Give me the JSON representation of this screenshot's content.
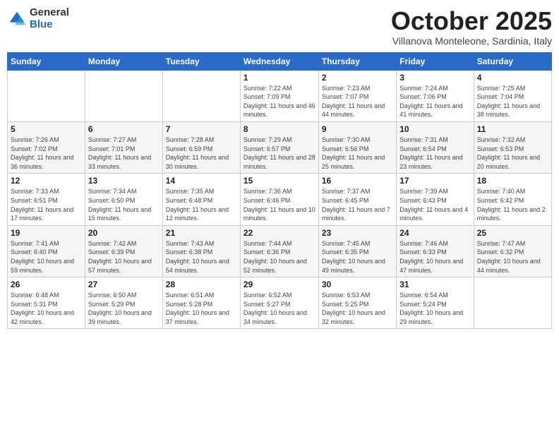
{
  "logo": {
    "general": "General",
    "blue": "Blue"
  },
  "title": "October 2025",
  "subtitle": "Villanova Monteleone, Sardinia, Italy",
  "days_header": [
    "Sunday",
    "Monday",
    "Tuesday",
    "Wednesday",
    "Thursday",
    "Friday",
    "Saturday"
  ],
  "weeks": [
    [
      {
        "day": "",
        "info": ""
      },
      {
        "day": "",
        "info": ""
      },
      {
        "day": "",
        "info": ""
      },
      {
        "day": "1",
        "info": "Sunrise: 7:22 AM\nSunset: 7:09 PM\nDaylight: 11 hours and 46 minutes."
      },
      {
        "day": "2",
        "info": "Sunrise: 7:23 AM\nSunset: 7:07 PM\nDaylight: 11 hours and 44 minutes."
      },
      {
        "day": "3",
        "info": "Sunrise: 7:24 AM\nSunset: 7:06 PM\nDaylight: 11 hours and 41 minutes."
      },
      {
        "day": "4",
        "info": "Sunrise: 7:25 AM\nSunset: 7:04 PM\nDaylight: 11 hours and 38 minutes."
      }
    ],
    [
      {
        "day": "5",
        "info": "Sunrise: 7:26 AM\nSunset: 7:02 PM\nDaylight: 11 hours and 36 minutes."
      },
      {
        "day": "6",
        "info": "Sunrise: 7:27 AM\nSunset: 7:01 PM\nDaylight: 11 hours and 33 minutes."
      },
      {
        "day": "7",
        "info": "Sunrise: 7:28 AM\nSunset: 6:59 PM\nDaylight: 11 hours and 30 minutes."
      },
      {
        "day": "8",
        "info": "Sunrise: 7:29 AM\nSunset: 6:57 PM\nDaylight: 11 hours and 28 minutes."
      },
      {
        "day": "9",
        "info": "Sunrise: 7:30 AM\nSunset: 6:56 PM\nDaylight: 11 hours and 25 minutes."
      },
      {
        "day": "10",
        "info": "Sunrise: 7:31 AM\nSunset: 6:54 PM\nDaylight: 11 hours and 23 minutes."
      },
      {
        "day": "11",
        "info": "Sunrise: 7:32 AM\nSunset: 6:53 PM\nDaylight: 11 hours and 20 minutes."
      }
    ],
    [
      {
        "day": "12",
        "info": "Sunrise: 7:33 AM\nSunset: 6:51 PM\nDaylight: 11 hours and 17 minutes."
      },
      {
        "day": "13",
        "info": "Sunrise: 7:34 AM\nSunset: 6:50 PM\nDaylight: 11 hours and 15 minutes."
      },
      {
        "day": "14",
        "info": "Sunrise: 7:35 AM\nSunset: 6:48 PM\nDaylight: 11 hours and 12 minutes."
      },
      {
        "day": "15",
        "info": "Sunrise: 7:36 AM\nSunset: 6:46 PM\nDaylight: 11 hours and 10 minutes."
      },
      {
        "day": "16",
        "info": "Sunrise: 7:37 AM\nSunset: 6:45 PM\nDaylight: 11 hours and 7 minutes."
      },
      {
        "day": "17",
        "info": "Sunrise: 7:39 AM\nSunset: 6:43 PM\nDaylight: 11 hours and 4 minutes."
      },
      {
        "day": "18",
        "info": "Sunrise: 7:40 AM\nSunset: 6:42 PM\nDaylight: 11 hours and 2 minutes."
      }
    ],
    [
      {
        "day": "19",
        "info": "Sunrise: 7:41 AM\nSunset: 6:40 PM\nDaylight: 10 hours and 59 minutes."
      },
      {
        "day": "20",
        "info": "Sunrise: 7:42 AM\nSunset: 6:39 PM\nDaylight: 10 hours and 57 minutes."
      },
      {
        "day": "21",
        "info": "Sunrise: 7:43 AM\nSunset: 6:38 PM\nDaylight: 10 hours and 54 minutes."
      },
      {
        "day": "22",
        "info": "Sunrise: 7:44 AM\nSunset: 6:36 PM\nDaylight: 10 hours and 52 minutes."
      },
      {
        "day": "23",
        "info": "Sunrise: 7:45 AM\nSunset: 6:35 PM\nDaylight: 10 hours and 49 minutes."
      },
      {
        "day": "24",
        "info": "Sunrise: 7:46 AM\nSunset: 6:33 PM\nDaylight: 10 hours and 47 minutes."
      },
      {
        "day": "25",
        "info": "Sunrise: 7:47 AM\nSunset: 6:32 PM\nDaylight: 10 hours and 44 minutes."
      }
    ],
    [
      {
        "day": "26",
        "info": "Sunrise: 6:48 AM\nSunset: 5:31 PM\nDaylight: 10 hours and 42 minutes."
      },
      {
        "day": "27",
        "info": "Sunrise: 6:50 AM\nSunset: 5:29 PM\nDaylight: 10 hours and 39 minutes."
      },
      {
        "day": "28",
        "info": "Sunrise: 6:51 AM\nSunset: 5:28 PM\nDaylight: 10 hours and 37 minutes."
      },
      {
        "day": "29",
        "info": "Sunrise: 6:52 AM\nSunset: 5:27 PM\nDaylight: 10 hours and 34 minutes."
      },
      {
        "day": "30",
        "info": "Sunrise: 6:53 AM\nSunset: 5:25 PM\nDaylight: 10 hours and 32 minutes."
      },
      {
        "day": "31",
        "info": "Sunrise: 6:54 AM\nSunset: 5:24 PM\nDaylight: 10 hours and 29 minutes."
      },
      {
        "day": "",
        "info": ""
      }
    ]
  ]
}
